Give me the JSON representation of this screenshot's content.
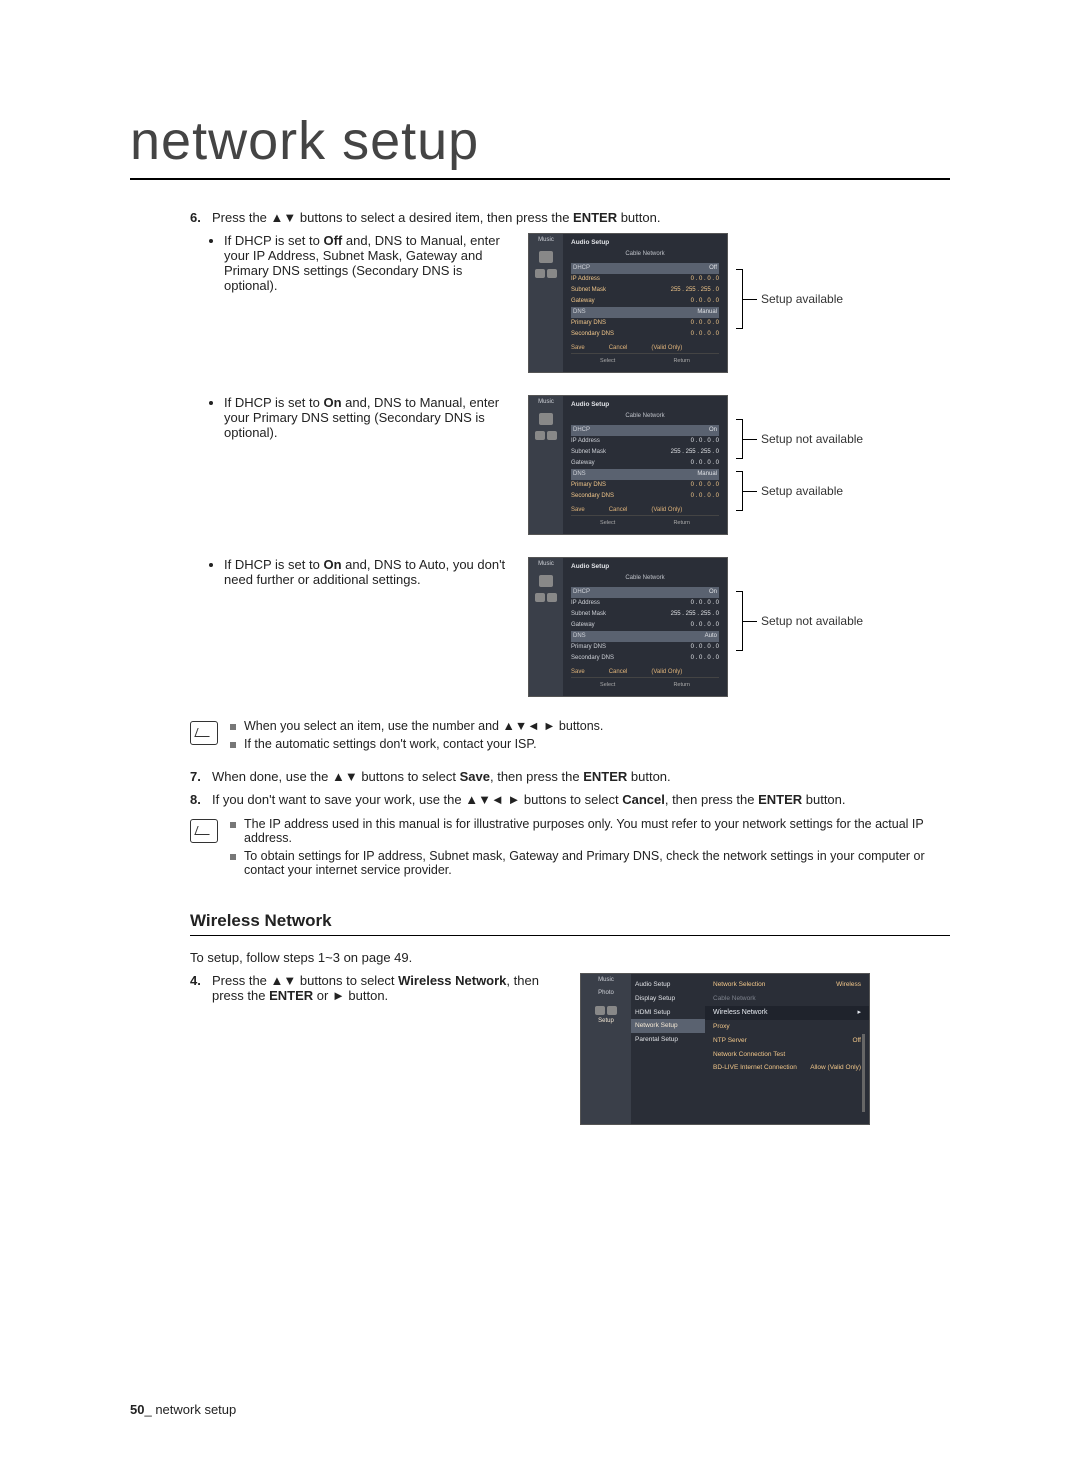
{
  "title": "network setup",
  "step6": {
    "num": "6.",
    "text_before": "Press the ",
    "text_after": " buttons to select a desired item, then press the ",
    "enter": "ENTER",
    "text_end": " button."
  },
  "block1": {
    "bullet_text": "If DHCP is set to ",
    "off": "Off",
    "bullet_text2": " and, DNS to Manual, enter your IP Address, Subnet Mask, Gateway and Primary DNS settings (Secondary DNS is optional).",
    "callout": "Setup available",
    "ui": {
      "tab": "Music",
      "title": "Audio Setup",
      "subtitle": "Cable Network",
      "dhcp": [
        "DHCP",
        "Off"
      ],
      "ip": [
        "IP Address",
        "0 . 0 . 0 . 0"
      ],
      "mask": [
        "Subnet Mask",
        "255 . 255 . 255 . 0"
      ],
      "gw": [
        "Gateway",
        "0 . 0 . 0 . 0"
      ],
      "dns": [
        "DNS",
        "Manual"
      ],
      "pdns": [
        "Primary DNS",
        "0 . 0 . 0 . 0"
      ],
      "sdns": [
        "Secondary DNS",
        "0 . 0 . 0 . 0"
      ],
      "save": "Save",
      "cancel": "Cancel",
      "valid": "(Valid Only)",
      "select": "Select",
      "return": "Return"
    }
  },
  "block2": {
    "bullet_text": "If DHCP is set to ",
    "on": "On",
    "bullet_text2": " and, DNS to Manual, enter your Primary DNS setting (Secondary DNS is optional).",
    "callout_a": "Setup not available",
    "callout_b": "Setup available",
    "ui": {
      "tab": "Music",
      "title": "Audio Setup",
      "subtitle": "Cable Network",
      "dhcp": [
        "DHCP",
        "On"
      ],
      "ip": [
        "IP Address",
        "0 . 0 . 0 . 0"
      ],
      "mask": [
        "Subnet Mask",
        "255 . 255 . 255 . 0"
      ],
      "gw": [
        "Gateway",
        "0 . 0 . 0 . 0"
      ],
      "dns": [
        "DNS",
        "Manual"
      ],
      "pdns": [
        "Primary DNS",
        "0 . 0 . 0 . 0"
      ],
      "sdns": [
        "Secondary DNS",
        "0 . 0 . 0 . 0"
      ],
      "save": "Save",
      "cancel": "Cancel",
      "valid": "(Valid Only)",
      "select": "Select",
      "return": "Return"
    }
  },
  "block3": {
    "bullet_text": "If DHCP is set to ",
    "on": "On",
    "bullet_text2": " and, DNS to Auto, you don't need further or additional settings.",
    "callout": "Setup not available",
    "ui": {
      "tab": "Music",
      "title": "Audio Setup",
      "subtitle": "Cable Network",
      "dhcp": [
        "DHCP",
        "On"
      ],
      "ip": [
        "IP Address",
        "0 . 0 . 0 . 0"
      ],
      "mask": [
        "Subnet Mask",
        "255 . 255 . 255 . 0"
      ],
      "gw": [
        "Gateway",
        "0 . 0 . 0 . 0"
      ],
      "dns": [
        "DNS",
        "Auto"
      ],
      "pdns": [
        "Primary DNS",
        "0 . 0 . 0 . 0"
      ],
      "sdns": [
        "Secondary DNS",
        "0 . 0 . 0 . 0"
      ],
      "save": "Save",
      "cancel": "Cancel",
      "valid": "(Valid Only)",
      "select": "Select",
      "return": "Return"
    }
  },
  "note1": {
    "a": "When you select an item, use the number and ▲▼◄ ► buttons.",
    "b": "If the automatic settings don't work, contact your ISP."
  },
  "step7": {
    "num": "7.",
    "text": "When done, use the ▲▼ buttons to select ",
    "save": "Save",
    "text2": ", then press the ",
    "enter": "ENTER",
    "text3": " button."
  },
  "step8": {
    "num": "8.",
    "text": "If you don't want to save your work, use the ▲▼◄ ► buttons to select ",
    "cancel": "Cancel",
    "text2": ", then press the ",
    "enter": "ENTER",
    "text3": " button."
  },
  "note2": {
    "a": "The IP address used in this manual is for illustrative purposes only. You must refer to your network settings for the actual IP address.",
    "b": "To obtain settings for IP address, Subnet mask, Gateway and Primary DNS, check the network settings in your computer or contact your internet service provider."
  },
  "wireless": {
    "heading": "Wireless Network",
    "intro": "To setup, follow steps 1~3 on page 49.",
    "step4_num": "4.",
    "step4_a": "Press the ▲▼ buttons to select ",
    "step4_bold": "Wireless Network",
    "step4_b": ", then press the ",
    "enter": "ENTER",
    "step4_c": " or ► button.",
    "ui": {
      "side_music": "Music",
      "side_photo": "Photo",
      "side_setup": "Setup",
      "menu": [
        "Audio Setup",
        "Display Setup",
        "HDMI Setup",
        "Network Setup",
        "Parental Setup"
      ],
      "r1": [
        "Network Selection",
        "Wireless"
      ],
      "r2": "Cable Network",
      "r3": "Wireless Network",
      "r4": "Proxy",
      "r5": [
        "NTP Server",
        "Off"
      ],
      "r6": "Network Connection Test",
      "r7": [
        "BD-LIVE Internet Connection",
        "Allow (Valid Only)"
      ]
    }
  },
  "footer": {
    "num": "50",
    "sep": "_",
    "label": " network setup"
  }
}
